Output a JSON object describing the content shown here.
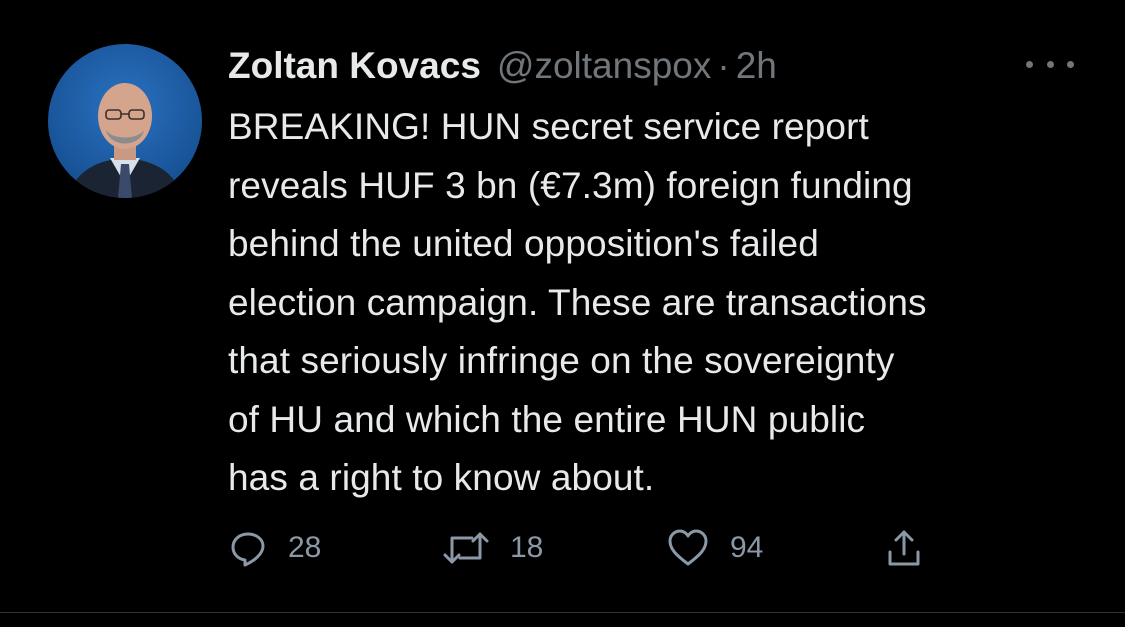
{
  "author": {
    "display_name": "Zoltan Kovacs",
    "handle": "@zoltanspox",
    "separator": "·",
    "time": "2h"
  },
  "tweet": {
    "lines": [
      "BREAKING! HUN secret service report",
      "reveals HUF 3 bn (€7.3m) foreign funding",
      "behind the united opposition's failed",
      "election campaign. These are transactions",
      "that seriously infringe on the sovereignty",
      "of HU and which the entire HUN public",
      "has a right to know about."
    ]
  },
  "actions": {
    "reply": {
      "icon": "reply-icon",
      "count": "28"
    },
    "retweet": {
      "icon": "retweet-icon",
      "count": "18"
    },
    "like": {
      "icon": "heart-icon",
      "count": "94"
    },
    "share": {
      "icon": "share-icon"
    }
  },
  "colors": {
    "background": "#000000",
    "text_primary": "#e7e9ea",
    "text_secondary": "#71767b",
    "avatar_bg": "#1d5fa8"
  }
}
